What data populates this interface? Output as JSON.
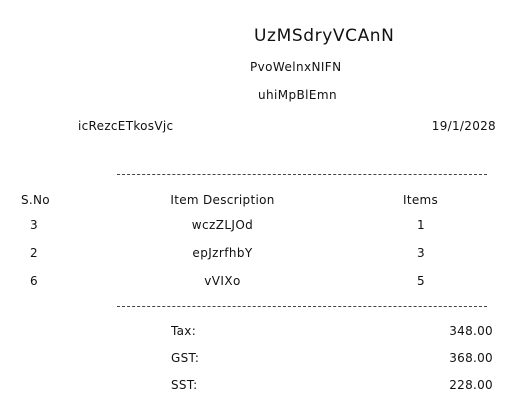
{
  "header": {
    "store_name": "UzMSdryVCAnN",
    "subtitle_1": "PvoWelnxNIFN",
    "subtitle_2": "uhiMpBlEmn",
    "cashier": "icRezcETkosVjc",
    "date": "19/1/2028"
  },
  "table": {
    "columns": [
      "S.No",
      "Item Description",
      "Items"
    ],
    "rows": [
      {
        "sno": "3",
        "description": "wczZLJOd",
        "items": "1"
      },
      {
        "sno": "2",
        "description": "epJzrfhbY",
        "items": "3"
      },
      {
        "sno": "6",
        "description": "vVIXo",
        "items": "5"
      }
    ]
  },
  "totals": [
    {
      "label": "Tax:",
      "value": "348.00"
    },
    {
      "label": "GST:",
      "value": "368.00"
    },
    {
      "label": "SST:",
      "value": "228.00"
    }
  ]
}
